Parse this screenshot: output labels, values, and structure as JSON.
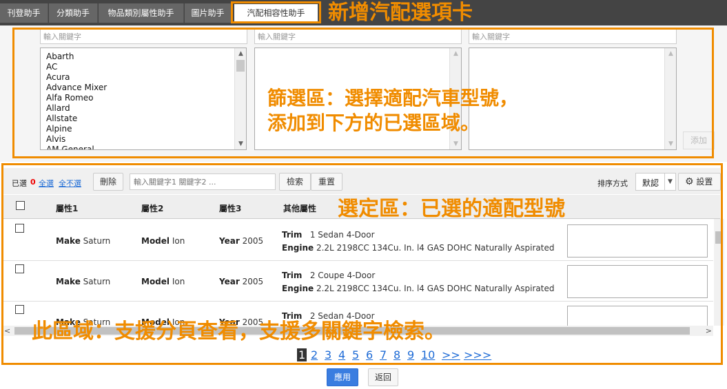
{
  "tabs": [
    {
      "label": "刊登助手"
    },
    {
      "label": "分類助手"
    },
    {
      "label": "物品類別屬性助手"
    },
    {
      "label": "圖片助手"
    },
    {
      "label": "汽配相容性助手"
    }
  ],
  "annotations": {
    "new_tab": "新增汽配選項卡",
    "filter_line1": "篩選區：選擇適配汽車型號，",
    "filter_line2": "添加到下方的已選區域。",
    "selected": "選定區：已選的適配型號",
    "paging": "此區域：支援分頁查看，支援多關鍵字檢索。",
    "color": "#f08c00"
  },
  "filter": {
    "placeholders": [
      "輸入關鍵字",
      "輸入關鍵字",
      "輸入關鍵字"
    ],
    "makes": [
      "Abarth",
      "AC",
      "Acura",
      "Advance Mixer",
      "Alfa Romeo",
      "Allard",
      "Allstate",
      "Alpine",
      "Alvis",
      "AM General"
    ],
    "add_label": "添加"
  },
  "toolbar": {
    "selected_label": "已選",
    "selected_count": "0",
    "select_all": "全選",
    "select_none": "全不選",
    "delete_label": "刪除",
    "search_placeholder": "輸入關鍵字1 關鍵字2 ...",
    "search_label": "檢索",
    "reset_label": "重置",
    "sort_label": "排序方式",
    "sort_value": "默認",
    "settings_label": "設置"
  },
  "table": {
    "headers": [
      "屬性1",
      "屬性2",
      "屬性3",
      "其他屬性"
    ],
    "rows": [
      {
        "k1": "Make",
        "v1": "Saturn",
        "k2": "Model",
        "v2": "Ion",
        "k3": "Year",
        "v3": "2005",
        "trim_key": "Trim",
        "trim": "1 Sedan 4-Door",
        "engine_key": "Engine",
        "engine": "2.2L 2198CC 134Cu. In. l4 GAS DOHC Naturally Aspirated"
      },
      {
        "k1": "Make",
        "v1": "Saturn",
        "k2": "Model",
        "v2": "Ion",
        "k3": "Year",
        "v3": "2005",
        "trim_key": "Trim",
        "trim": "2 Coupe 4-Door",
        "engine_key": "Engine",
        "engine": "2.2L 2198CC 134Cu. In. l4 GAS DOHC Naturally Aspirated"
      },
      {
        "k1": "Make",
        "v1": "Saturn",
        "k2": "Model",
        "v2": "Ion",
        "k3": "Year",
        "v3": "2005",
        "trim_key": "Trim",
        "trim": "2 Sedan 4-Door"
      }
    ]
  },
  "pagination": {
    "pages": [
      "1",
      "2",
      "3",
      "4",
      "5",
      "6",
      "7",
      "8",
      "9",
      "10"
    ],
    "current": "1",
    "next": ">>",
    "last": ">>>"
  },
  "footer": {
    "apply_label": "應用",
    "back_label": "返回"
  }
}
